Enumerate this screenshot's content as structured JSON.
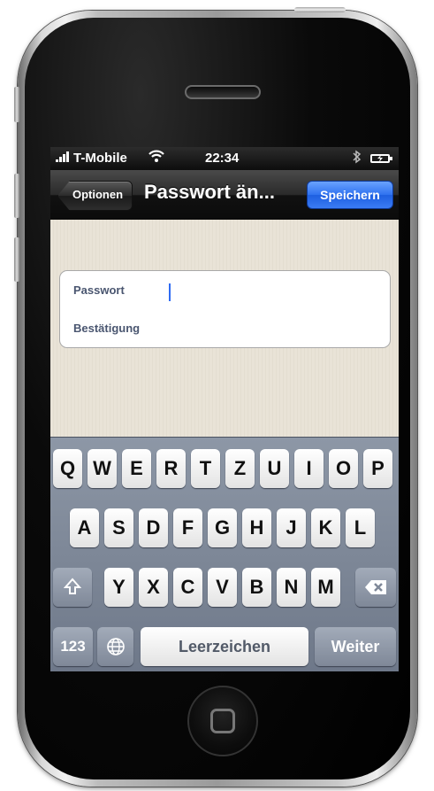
{
  "status_bar": {
    "carrier": "T-Mobile",
    "time": "22:34",
    "wifi_icon": "wifi-icon",
    "bluetooth_icon": "bluetooth-icon",
    "battery_icon": "battery-charging-icon"
  },
  "nav_bar": {
    "back_label": "Optionen",
    "title": "Passwort än...",
    "save_label": "Speichern"
  },
  "form": {
    "password_label": "Passwort",
    "password_value": "",
    "confirm_label": "Bestätigung",
    "confirm_value": ""
  },
  "keyboard": {
    "row1": [
      "Q",
      "W",
      "E",
      "R",
      "T",
      "Z",
      "U",
      "I",
      "O",
      "P"
    ],
    "row2": [
      "A",
      "S",
      "D",
      "F",
      "G",
      "H",
      "J",
      "K",
      "L"
    ],
    "row3": [
      "Y",
      "X",
      "C",
      "V",
      "B",
      "N",
      "M"
    ],
    "shift_icon": "shift-arrow-icon",
    "backspace_icon": "backspace-icon",
    "numbers_label": "123",
    "globe_icon": "globe-icon",
    "space_label": "Leerzeichen",
    "return_label": "Weiter"
  },
  "colors": {
    "save_button": "#2f72f0",
    "caret": "#2f6bf3",
    "field_label": "#4a5670",
    "background_texture": "#e9e3d7"
  }
}
